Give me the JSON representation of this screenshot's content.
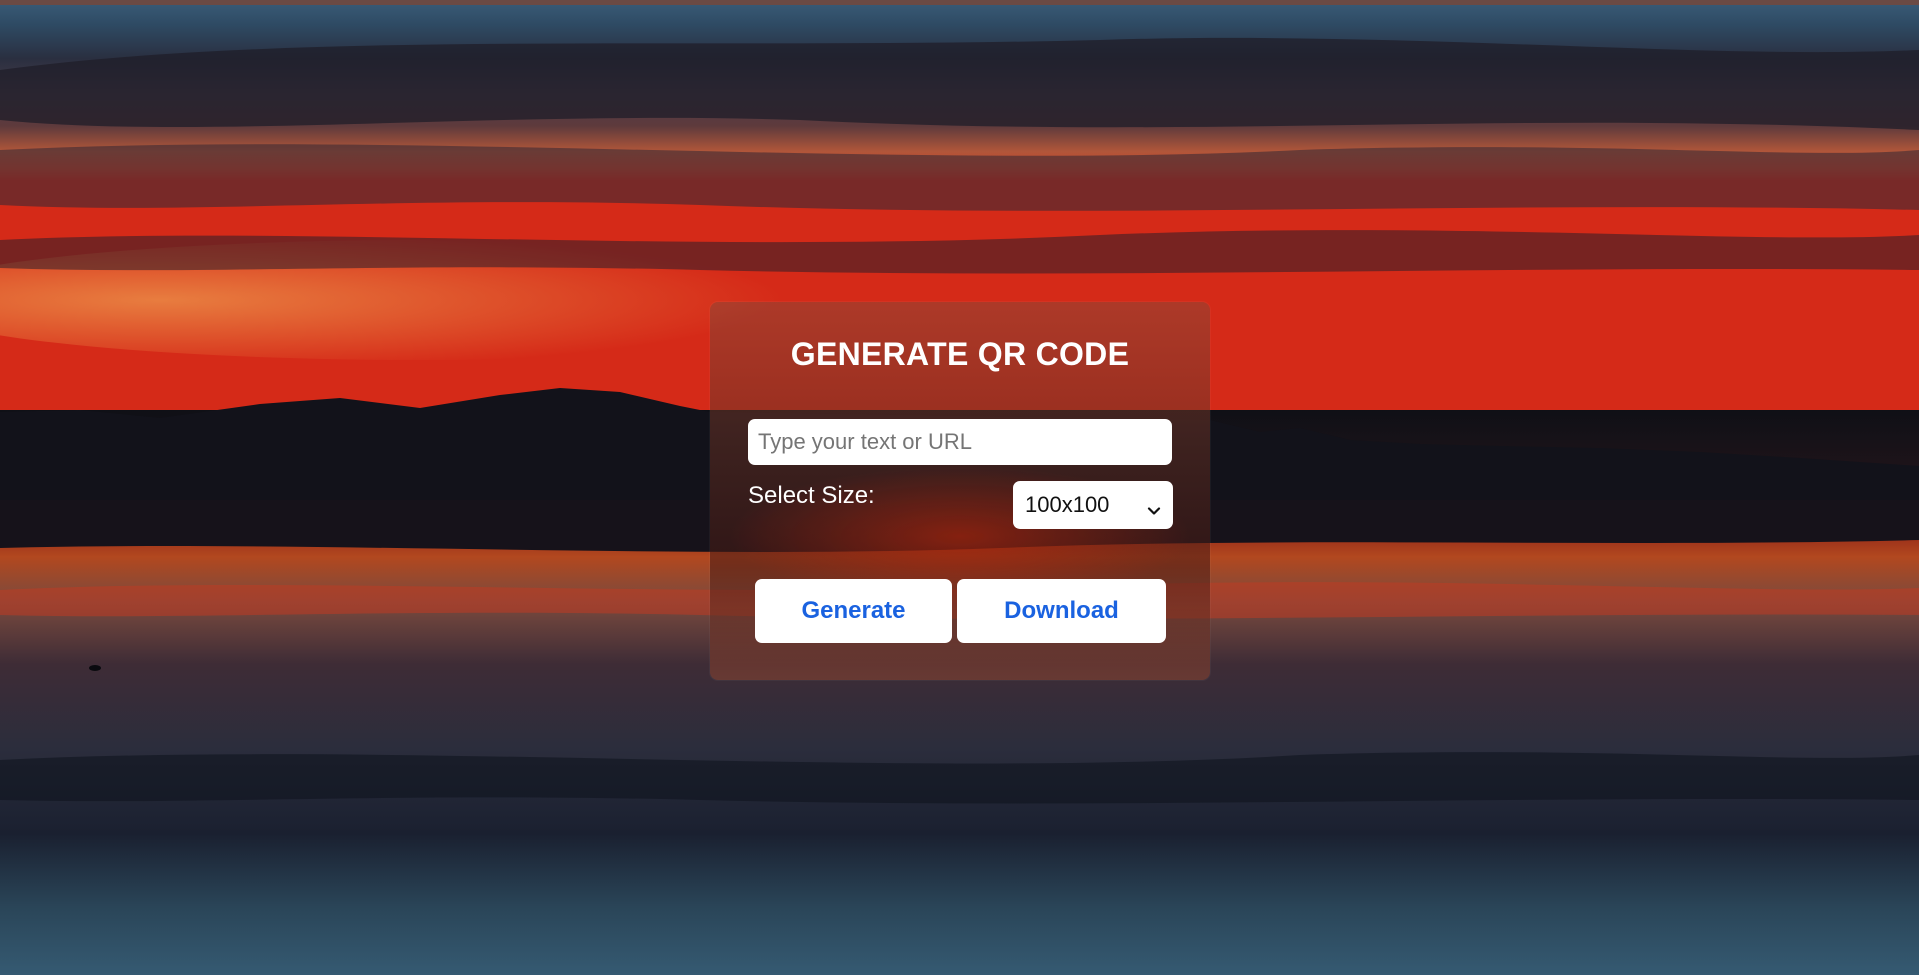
{
  "form": {
    "title": "GENERATE QR CODE",
    "input_placeholder": "Type your text or URL",
    "input_value": "",
    "size_label": "Select Size:",
    "size_selected": "100x100",
    "generate_label": "Generate",
    "download_label": "Download"
  },
  "colors": {
    "button_text": "#1a62e0",
    "title_text": "#ffffff"
  }
}
